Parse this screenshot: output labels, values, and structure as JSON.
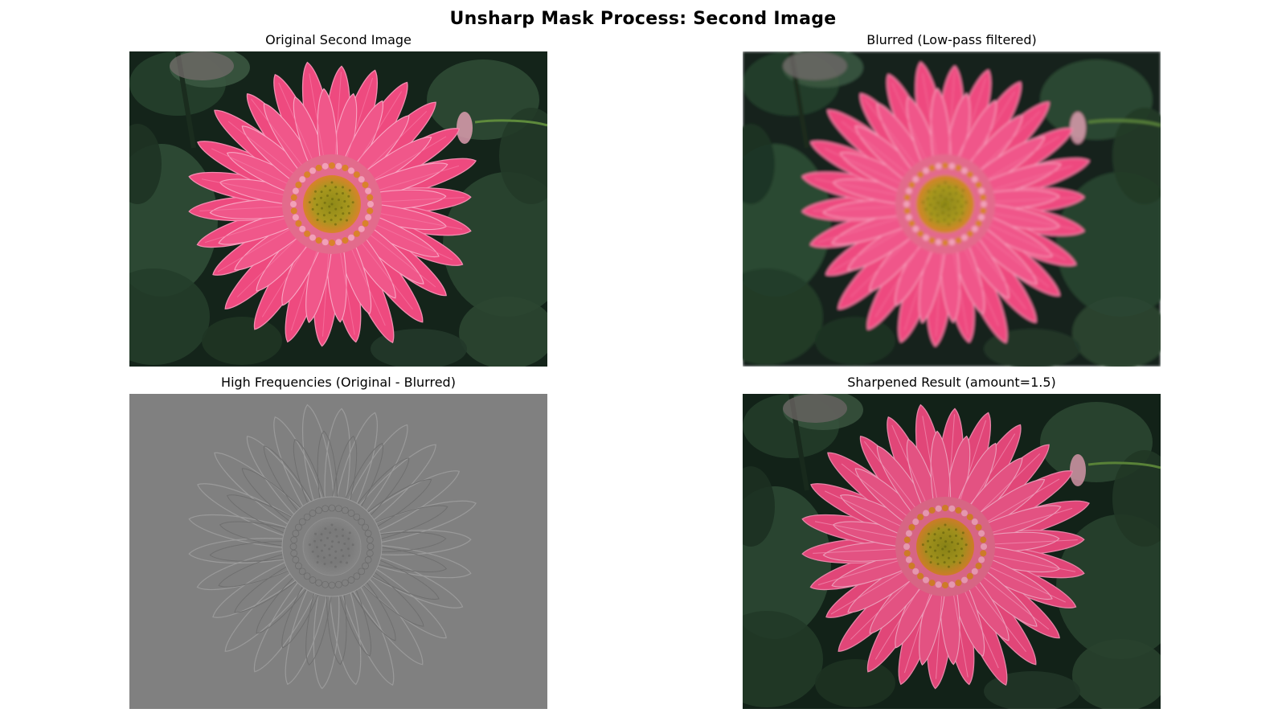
{
  "figure": {
    "title": "Unsharp Mask Process: Second Image"
  },
  "panels": [
    {
      "title": "Original Second Image",
      "variant": "original"
    },
    {
      "title": "Blurred (Low-pass filtered)",
      "variant": "blurred"
    },
    {
      "title": "High Frequencies (Original - Blurred)",
      "variant": "highpass"
    },
    {
      "title": "Sharpened Result (amount=1.5)",
      "variant": "sharpened"
    }
  ],
  "colors": {
    "petal": "#ee4a7f",
    "petal_light": "#f48bb0",
    "foliage_dark": "#14241a",
    "foliage": "#2e4a35",
    "center_yellow": "#a8971e",
    "center_orange": "#d9822b",
    "highpass_gray": "#808080"
  }
}
